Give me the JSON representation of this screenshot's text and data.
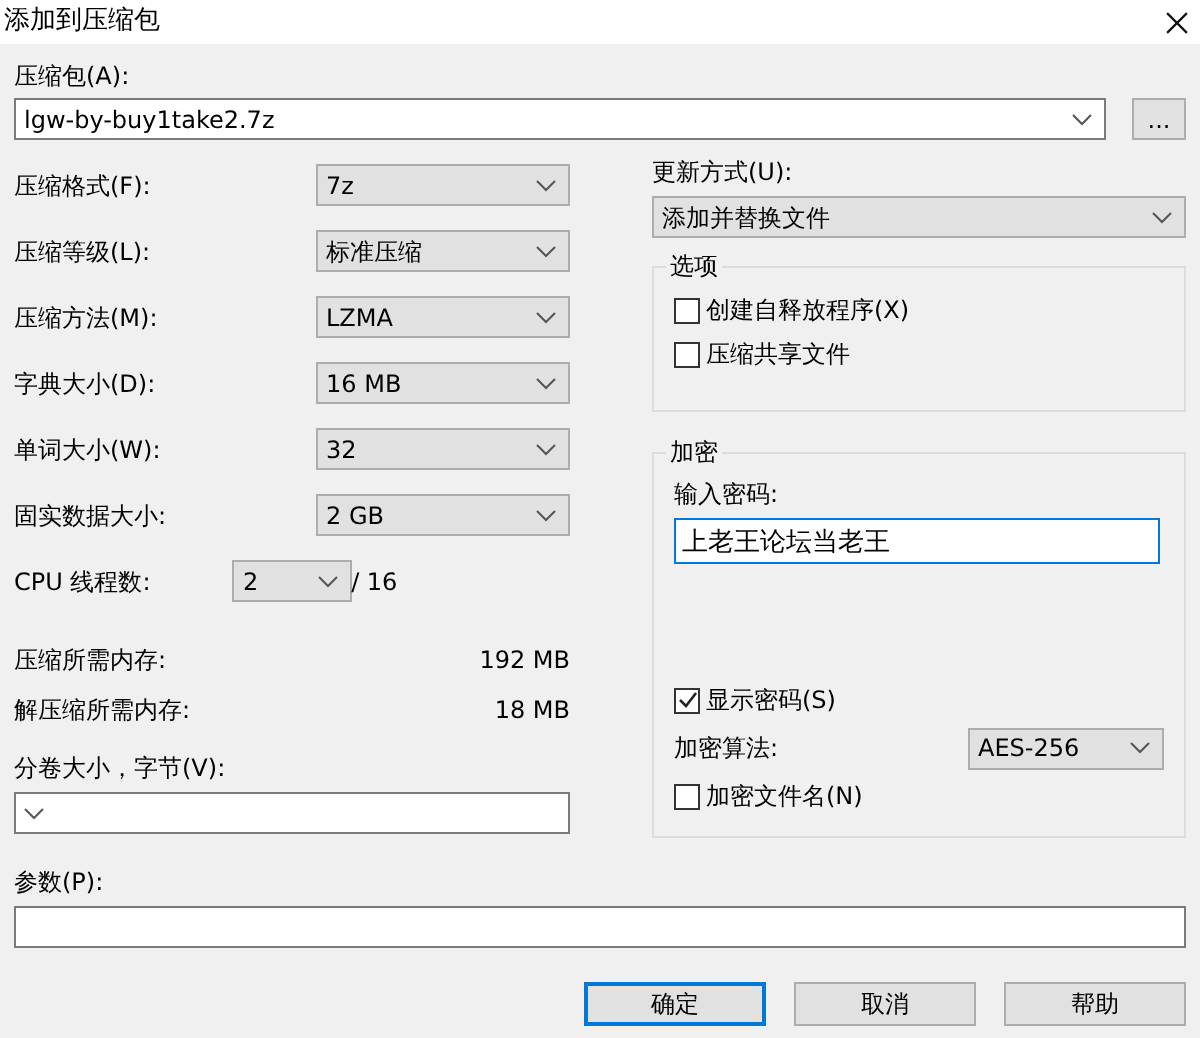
{
  "window": {
    "title": "添加到压缩包"
  },
  "archive": {
    "label": "压缩包(A):",
    "value": "lgw-by-buy1take2.7z",
    "browse": "..."
  },
  "settings": [
    {
      "label": "压缩格式(F):",
      "value": "7z"
    },
    {
      "label": "压缩等级(L):",
      "value": "标准压缩"
    },
    {
      "label": "压缩方法(M):",
      "value": "LZMA"
    },
    {
      "label": "字典大小(D):",
      "value": "16 MB"
    },
    {
      "label": "单词大小(W):",
      "value": "32"
    },
    {
      "label": "固实数据大小:",
      "value": "2 GB"
    },
    {
      "label": "CPU 线程数:",
      "value": "2",
      "suffix": "/ 16"
    }
  ],
  "memory": [
    {
      "label": "压缩所需内存:",
      "value": "192 MB"
    },
    {
      "label": "解压缩所需内存:",
      "value": "18 MB"
    }
  ],
  "volume": {
    "label": "分卷大小，字节(V):"
  },
  "update_mode": {
    "label": "更新方式(U):",
    "value": "添加并替换文件"
  },
  "options": {
    "title": "选项",
    "items": [
      {
        "label": "创建自释放程序(X)",
        "checked": false
      },
      {
        "label": "压缩共享文件",
        "checked": false
      }
    ]
  },
  "encryption": {
    "title": "加密",
    "password_label": "输入密码:",
    "password": "上老王论坛当老王",
    "show_password": {
      "label": "显示密码(S)",
      "checked": true
    },
    "method_label": "加密算法:",
    "method": "AES-256",
    "encrypt_names": {
      "label": "加密文件名(N)",
      "checked": false
    }
  },
  "parameters": {
    "label": "参数(P):"
  },
  "buttons": [
    {
      "label": "确定",
      "default": true
    },
    {
      "label": "取消",
      "default": false
    },
    {
      "label": "帮助",
      "default": false
    }
  ]
}
